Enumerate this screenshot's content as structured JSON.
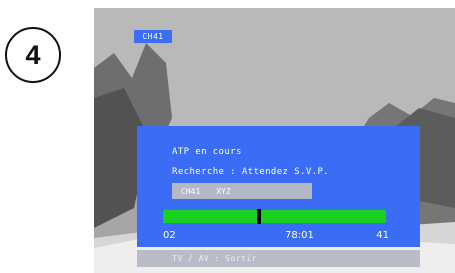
{
  "step_number": "4",
  "channel_badge": "CH41",
  "osd": {
    "title": "ATP en cours",
    "status": "Recherche : Attendez S.V.P.",
    "channel_code": "CH41",
    "channel_name": "XYZ",
    "progress": {
      "min_label": "02",
      "current_label": "78:01",
      "max_label": "41",
      "marker_fraction": 0.42
    }
  },
  "footer_hint": "TV / AV : Sortir",
  "colors": {
    "osd_blue": "#3a6cf6",
    "progress_green": "#19d21f",
    "hint_grey": "#b8bcc6"
  }
}
